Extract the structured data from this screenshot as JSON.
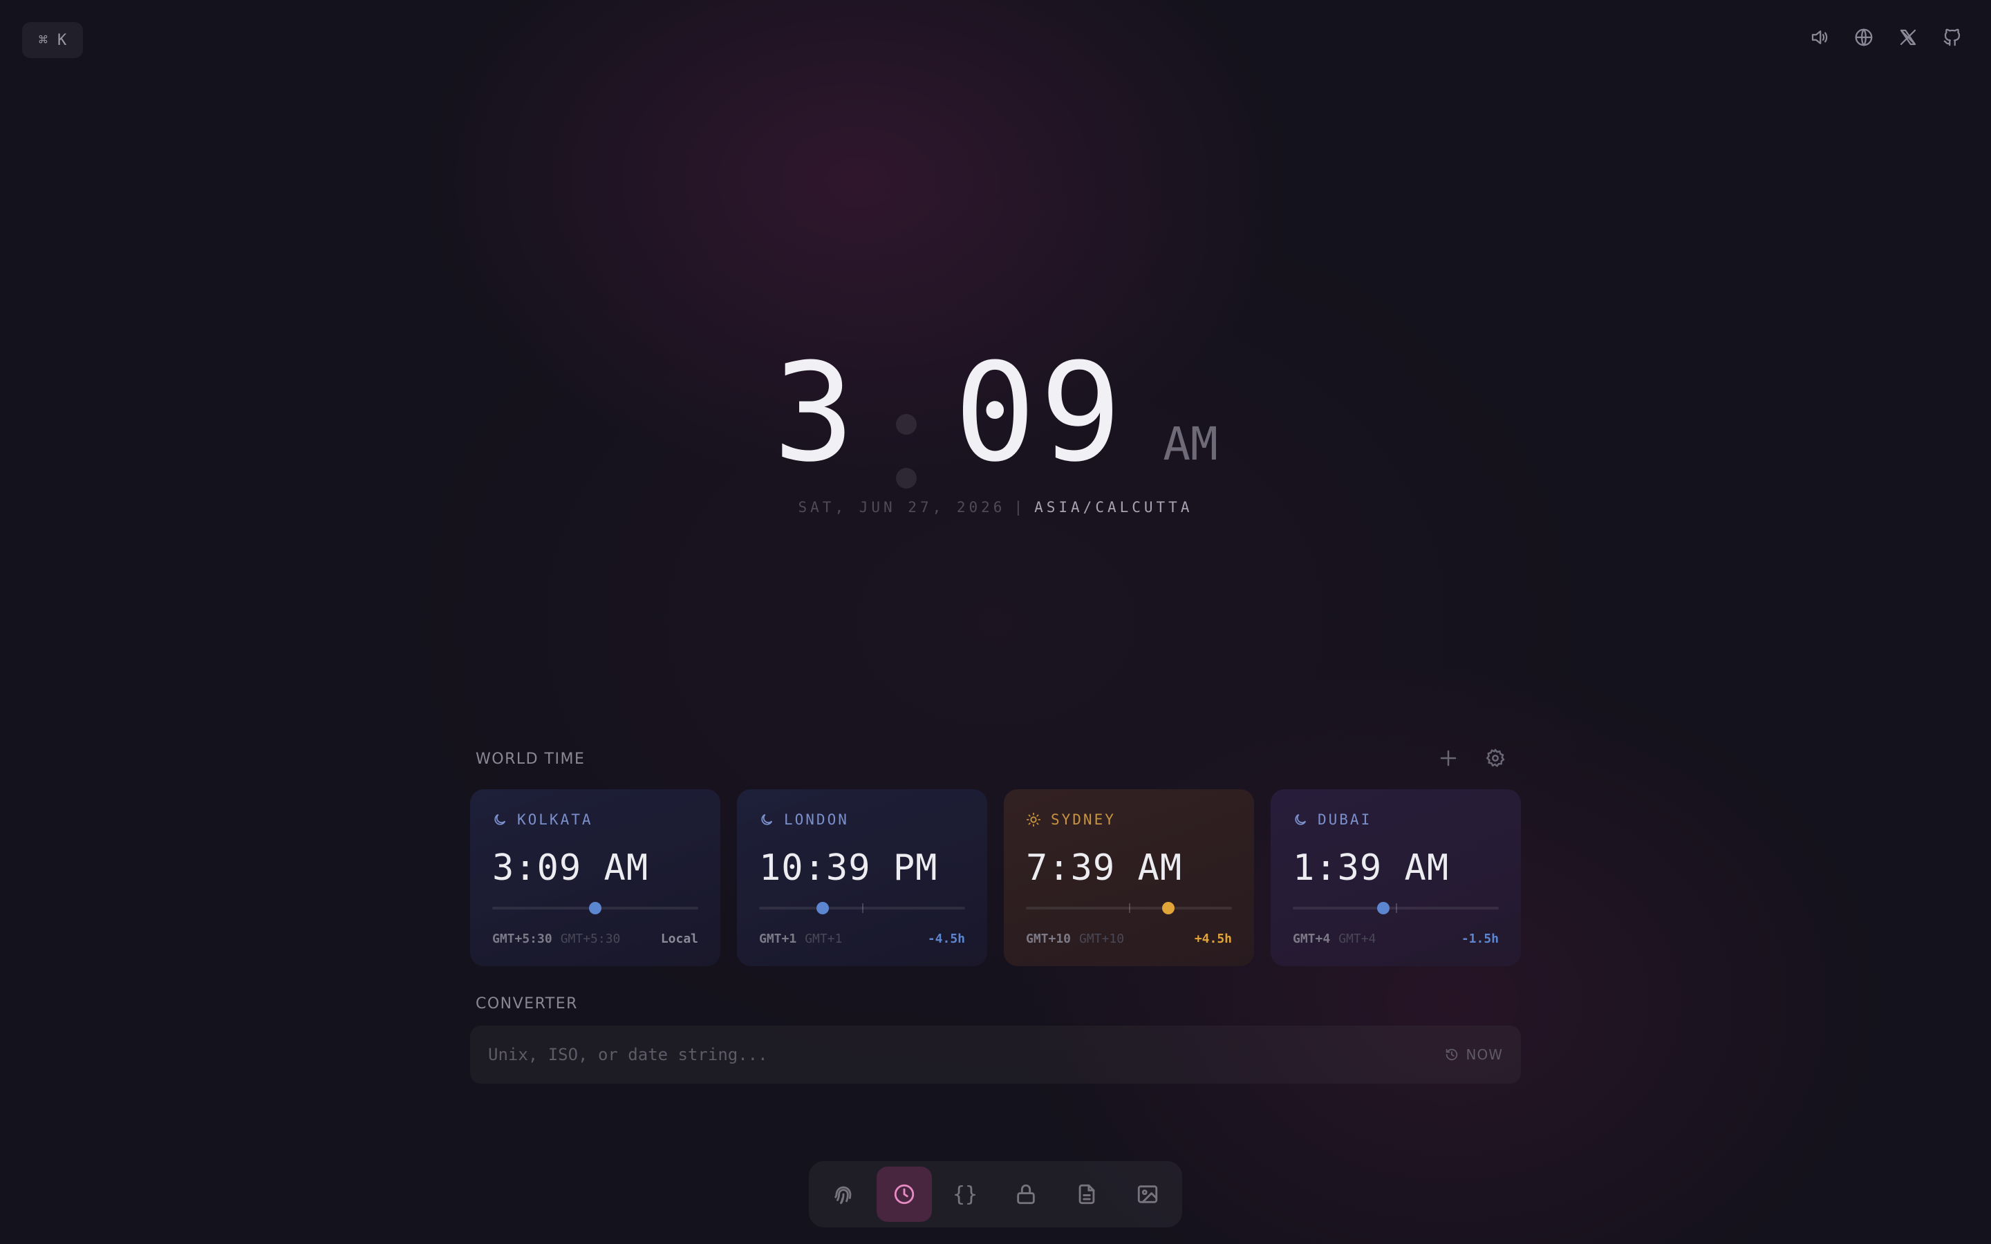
{
  "command_badge": {
    "symbol": "⌘",
    "key": "K"
  },
  "top_icons": [
    "speaker-icon",
    "globe-icon",
    "x-logo-icon",
    "github-icon"
  ],
  "clock": {
    "hour": "3",
    "minute": "09",
    "ampm": "AM",
    "date": "SAT, JUN 27, 2026",
    "separator": "|",
    "timezone": "ASIA/CALCUTTA"
  },
  "world_time": {
    "label": "WORLD TIME",
    "cities": [
      {
        "name": "KOLKATA",
        "icon": "moon-icon",
        "time": "3:09 AM",
        "gmt": "GMT+5:30",
        "gmt_dim": "GMT+5:30",
        "offset": "Local",
        "day_progress": 0.5
      },
      {
        "name": "LONDON",
        "icon": "moon-icon",
        "time": "10:39 PM",
        "gmt": "GMT+1",
        "gmt_dim": "GMT+1",
        "offset": "-4.5h",
        "day_progress": 0.31
      },
      {
        "name": "SYDNEY",
        "icon": "sun-icon",
        "time": "7:39 AM",
        "gmt": "GMT+10",
        "gmt_dim": "GMT+10",
        "offset": "+4.5h",
        "day_progress": 0.69
      },
      {
        "name": "DUBAI",
        "icon": "moon-icon",
        "time": "1:39 AM",
        "gmt": "GMT+4",
        "gmt_dim": "GMT+4",
        "offset": "-1.5h",
        "day_progress": 0.44
      }
    ]
  },
  "converter": {
    "label": "CONVERTER",
    "placeholder": "Unix, ISO, or date string...",
    "now_label": "NOW"
  },
  "dock": {
    "items": [
      "fingerprint-icon",
      "clock-icon",
      "braces-icon",
      "lock-icon",
      "document-icon",
      "image-icon"
    ],
    "braces_text": "{}",
    "active": "clock-icon"
  },
  "colors": {
    "night_accent": "#7b8fca",
    "day_accent": "#e1a438",
    "active_dock": "#e68bc4"
  }
}
